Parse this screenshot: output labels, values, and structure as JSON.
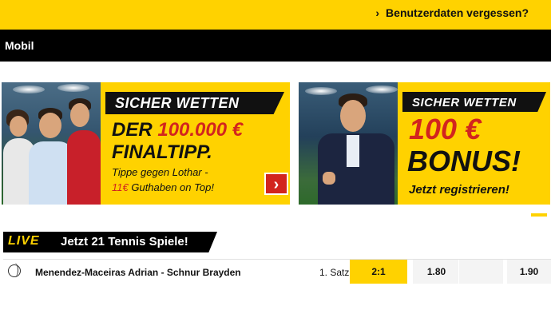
{
  "topbar": {
    "forgot_label": "Benutzerdaten vergessen?",
    "chevron": "›"
  },
  "nav": {
    "title": "Mobil"
  },
  "banner1": {
    "tagline": "SICHER WETTEN",
    "line1_prefix": "DER ",
    "line1_amount": "100.000 €",
    "line2": "FINALTIPP.",
    "line3": "Tippe gegen Lothar -",
    "line4_amount": "11€",
    "line4_rest": " Guthaben on Top!",
    "arrow": "›"
  },
  "banner2": {
    "tagline": "SICHER WETTEN",
    "amount": "100 €",
    "bonus": "BONUS!",
    "register": "Jetzt registrieren!"
  },
  "live": {
    "logo": "LIVE",
    "text": "Jetzt 21 Tennis Spiele!"
  },
  "match": {
    "sport_icon": "tennis-ball-icon",
    "name": "Menendez-Maceiras Adrian - Schnur Brayden",
    "set": "1. Satz",
    "score": "2:1",
    "odd1": "1.80",
    "oddx": "",
    "odd2": "1.90"
  },
  "colors": {
    "accent": "#ffd200",
    "black": "#000000",
    "red": "#d2251e"
  }
}
